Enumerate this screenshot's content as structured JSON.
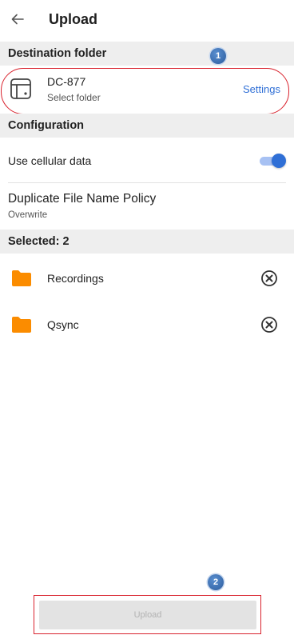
{
  "header": {
    "title": "Upload",
    "back_icon": "arrow-left-icon"
  },
  "destination": {
    "section_label": "Destination folder",
    "device_name": "DC-877",
    "subtitle": "Select folder",
    "settings_label": "Settings",
    "icon": "nas-device-icon"
  },
  "configuration": {
    "section_label": "Configuration",
    "cellular": {
      "label": "Use cellular data",
      "enabled": true
    },
    "policy": {
      "label": "Duplicate File Name Policy",
      "value": "Overwrite"
    }
  },
  "selected": {
    "section_label": "Selected: 2",
    "items": [
      {
        "name": "Recordings",
        "icon": "folder-icon"
      },
      {
        "name": "Qsync",
        "icon": "folder-icon"
      }
    ]
  },
  "badges": {
    "first": "1",
    "second": "2"
  },
  "footer": {
    "upload_label": "Upload"
  },
  "colors": {
    "accent": "#2f6fd6",
    "folder": "#fb8c00",
    "annotation": "#d9232e",
    "badge": "#3b6fb0"
  }
}
